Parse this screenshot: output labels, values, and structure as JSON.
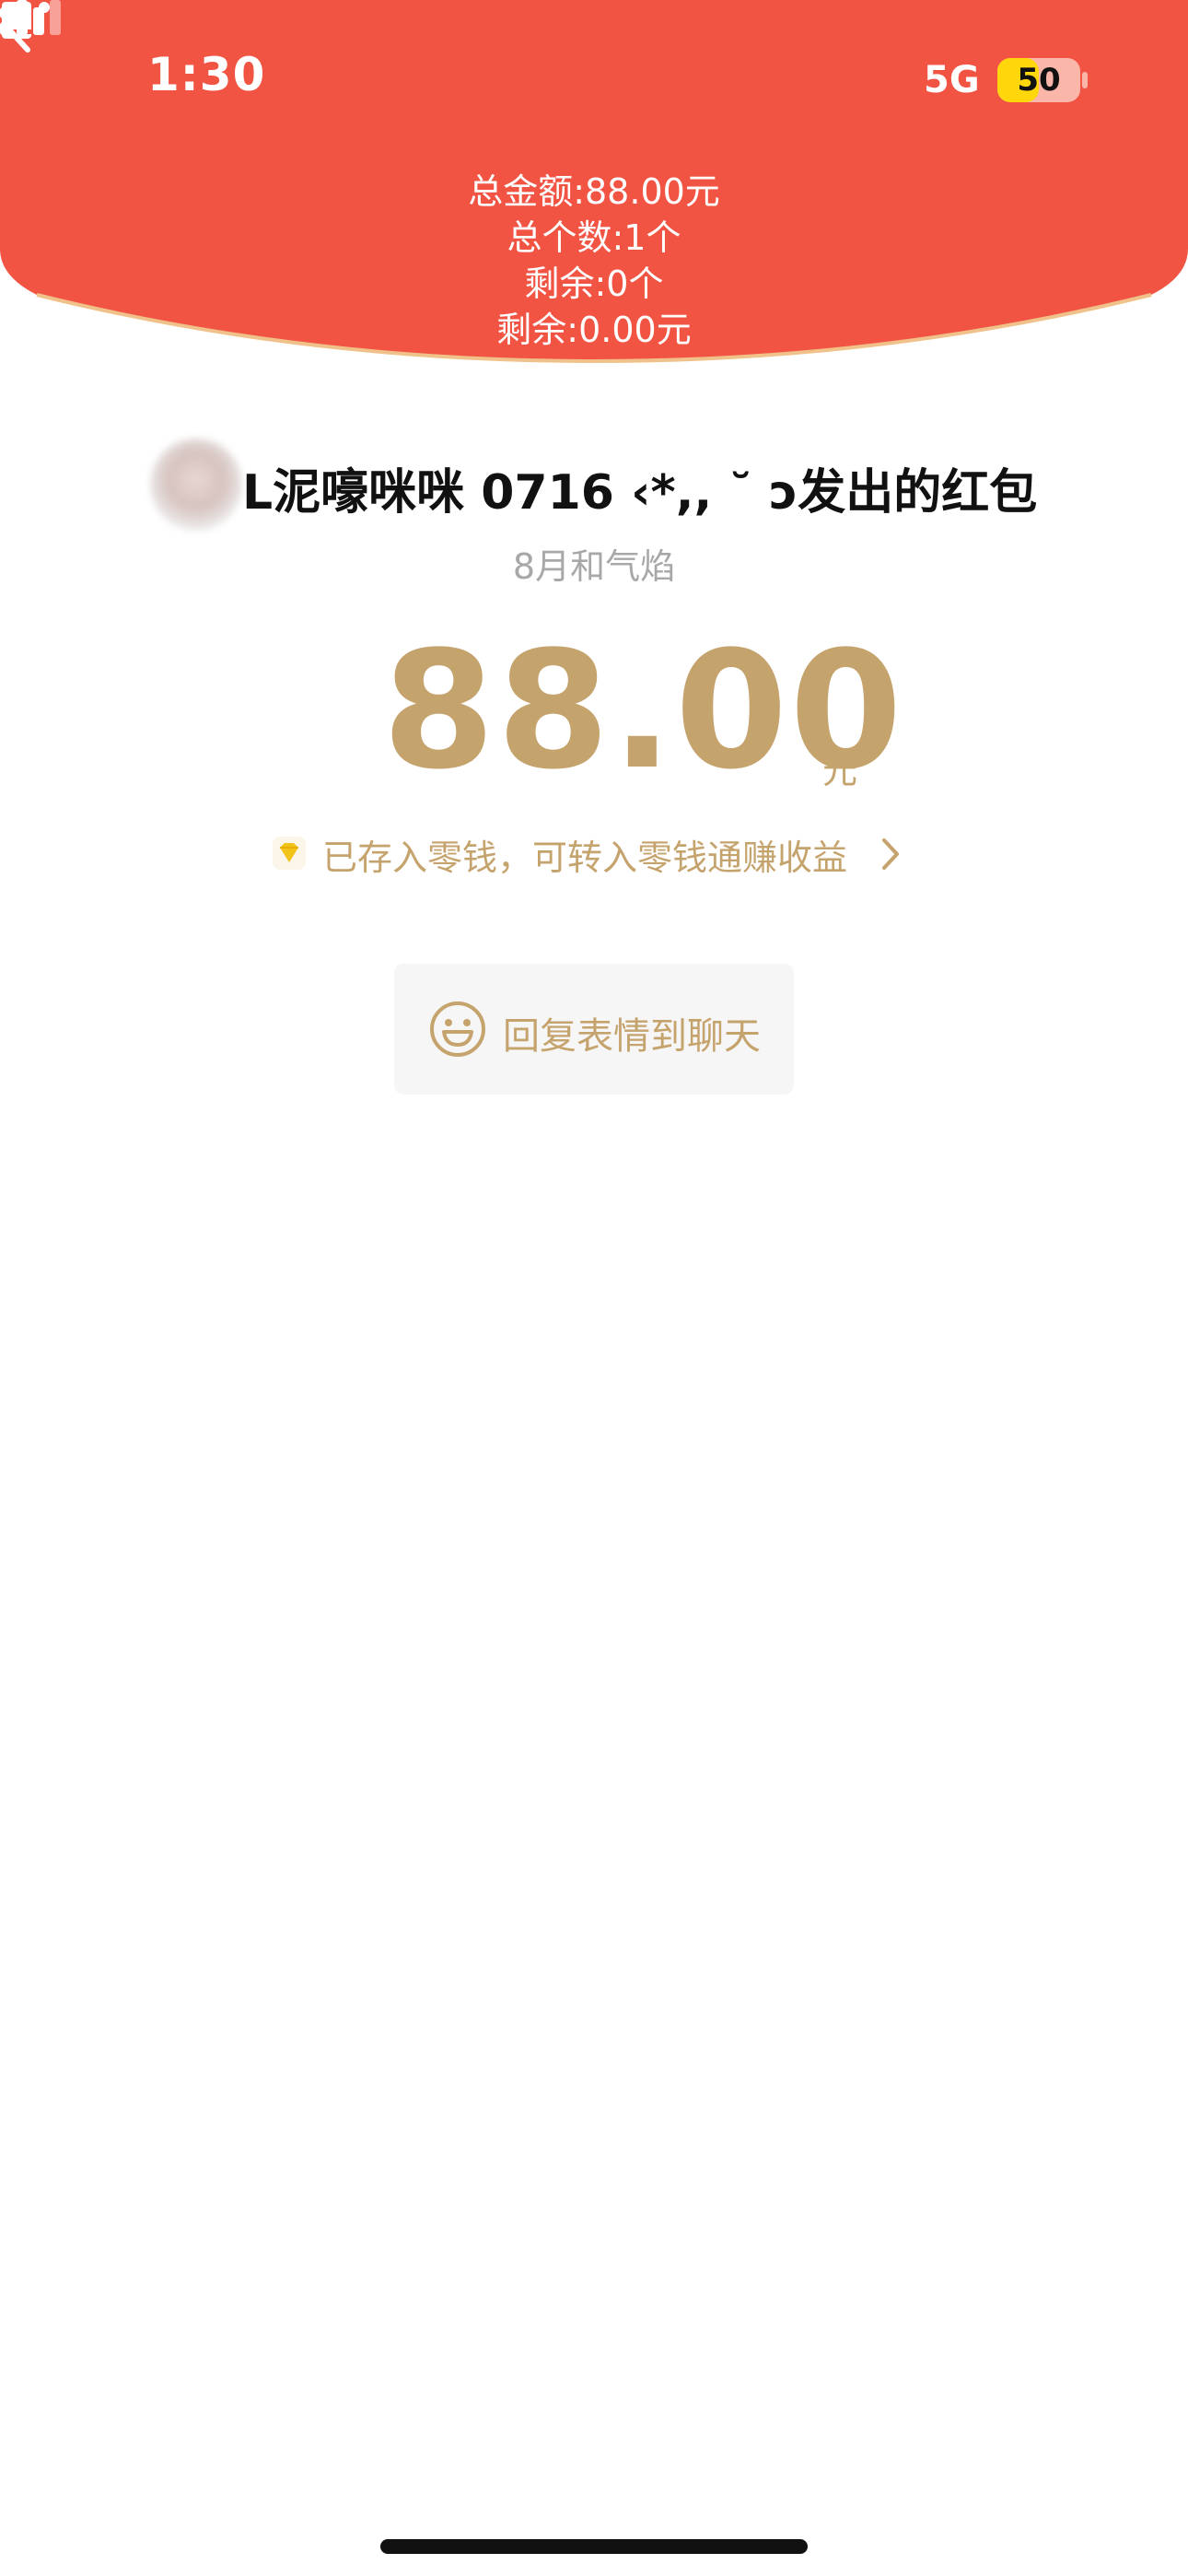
{
  "status_bar": {
    "time": "1:30",
    "network": "5G",
    "battery": "50",
    "battery_level": 0.5
  },
  "header": {
    "total_amount": "总金额:88.00元",
    "total_count": "总个数:1个",
    "remaining_count": "剩余:0个",
    "remaining_amount": "剩余:0.00元"
  },
  "sender": {
    "name": "L泥嚎咪咪 0716 ‹*,, ˘ ɔ发出的红包",
    "blessing": "8月和气焰"
  },
  "amount": {
    "value": "88.00",
    "unit": "元"
  },
  "wallet_notice": "已存入零钱，可转入零钱通赚收益",
  "reply_button": {
    "label": "回复表情到聊天"
  },
  "colors": {
    "header_red": "#f25444",
    "gold": "#c5a36d",
    "gold_border": "#f0c28a"
  },
  "icons": [
    "book-icon",
    "signal-icon",
    "back-icon",
    "more-icon",
    "diamond-icon",
    "chevron-right-icon",
    "smile-icon"
  ]
}
